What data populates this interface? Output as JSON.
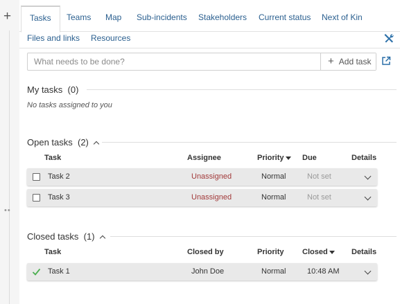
{
  "tabs": {
    "row1": [
      "Tasks",
      "Teams",
      "Map",
      "Sub-incidents",
      "Stakeholders",
      "Current status",
      "Next of Kin"
    ],
    "row2": [
      "Files and links",
      "Resources"
    ],
    "active": "Tasks"
  },
  "new_task": {
    "placeholder": "What needs to be done?",
    "value": "",
    "add_label": "Add task"
  },
  "my_tasks": {
    "title": "My tasks",
    "count": "(0)",
    "empty_text": "No tasks assigned to you"
  },
  "open_tasks": {
    "title": "Open tasks",
    "count": "(2)",
    "columns": [
      "Task",
      "Assignee",
      "Priority",
      "Due",
      "Details"
    ],
    "sorted_by": "Priority",
    "rows": [
      {
        "task": "Task 2",
        "assignee": "Unassigned",
        "priority": "Normal",
        "due": "Not set"
      },
      {
        "task": "Task 3",
        "assignee": "Unassigned",
        "priority": "Normal",
        "due": "Not set"
      }
    ]
  },
  "closed_tasks": {
    "title": "Closed tasks",
    "count": "(1)",
    "columns": [
      "Task",
      "Closed by",
      "Priority",
      "Closed",
      "Details"
    ],
    "sorted_by": "Closed",
    "rows": [
      {
        "task": "Task 1",
        "closed_by": "John Doe",
        "priority": "Normal",
        "closed": "10:48 AM"
      }
    ]
  },
  "colors": {
    "link": "#2a5f8f",
    "unassigned": "#a23a3a",
    "check": "#4caf50",
    "tools_icon": "#2a6fa8",
    "row_bg": "#e9e9e9"
  },
  "icons": {
    "add_panel": "plus-icon",
    "tools": "tools-icon",
    "add_task": "plus-icon",
    "open_external": "external-link-icon",
    "collapse": "chevron-up-icon",
    "expand_row": "chevron-down-icon",
    "completed": "checkmark-icon",
    "resize": "drag-handle-icon"
  }
}
